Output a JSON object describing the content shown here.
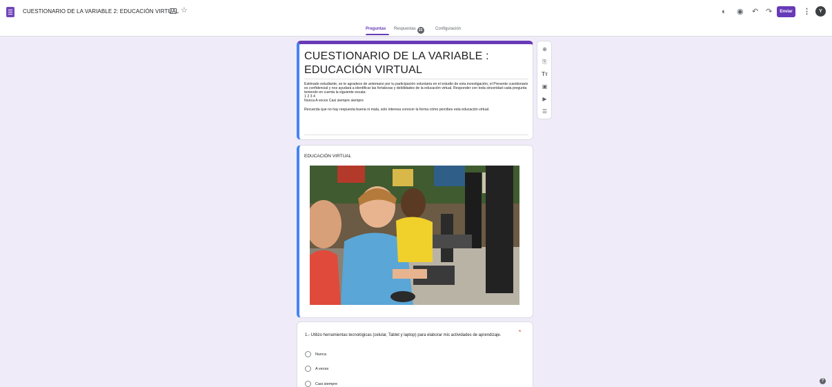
{
  "app": {
    "doc_title": "CUESTIONARIO DE LA VARIABLE 2: EDUCACIÓN VIRTUAL"
  },
  "toolbar": {
    "send_label": "Enviar",
    "avatar_initial": "Y"
  },
  "tabs": [
    {
      "label": "Preguntas",
      "active": true
    },
    {
      "label": "Respuestas",
      "badge": "23"
    },
    {
      "label": "Configuración"
    }
  ],
  "form": {
    "title": "CUESTIONARIO DE LA VARIABLE : EDUCACIÓN VIRTUAL",
    "description": "Estimado estudiante, se te agradece de antemano por tu participación voluntaria en el estudio de esta investigación, el Presente cuestionario es confidencial y nos ayudará a identificar las fortalezas y debilidades de la educación virtual. Responder con toda sinceridad cada pregunta  teniendo en cuenta la siguiente escala:\n     1             2                  3                   4\nNunca   A veces    Casi siempre     siempre\n\nRecuerda que no hay respuesta buena ni mala, solo interesa conocer la forma cómo  percibes esta educación virtual."
  },
  "section": {
    "title": "EDUCACIÓN VIRTUAL"
  },
  "question1": {
    "text": "1.- Utilizo herramientas tecnológicas (celular, Tablet y laptop) para elaborar mis actividades de aprendizaje.",
    "required_mark": "*",
    "options": [
      "Nunca",
      "A veces",
      "Casi siempre"
    ]
  },
  "colors": {
    "accent": "#673ab7",
    "background": "#f0ebf8",
    "section_border": "#4285f4"
  }
}
